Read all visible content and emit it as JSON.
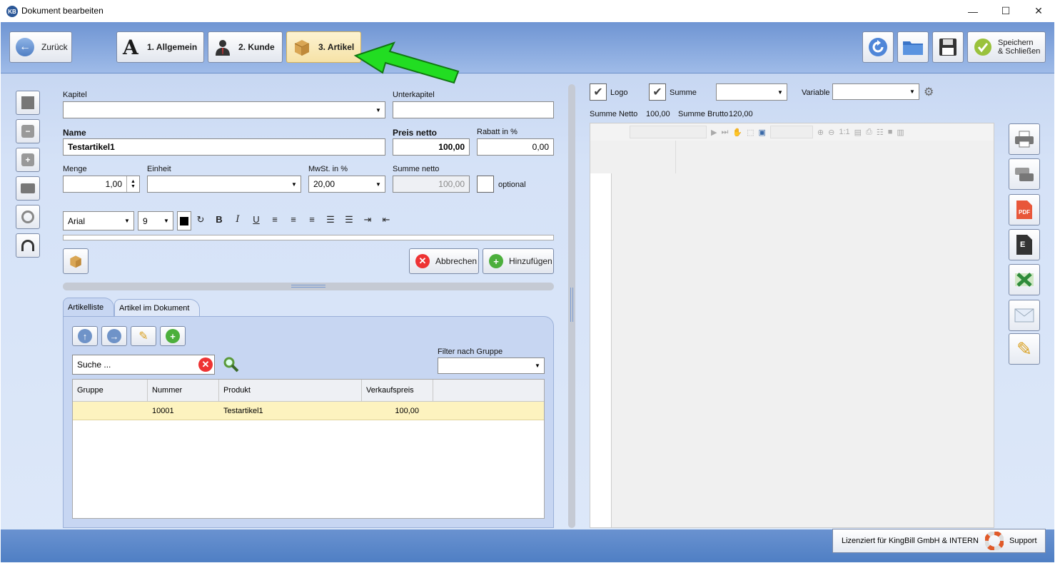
{
  "window": {
    "title": "Dokument bearbeiten",
    "app_icon": "KB"
  },
  "toolbar": {
    "back_label": "Zurück",
    "tab1_label": "1. Allgemein",
    "tab2_label": "2. Kunde",
    "tab3_label": "3. Artikel",
    "save_close_line1": "Speichern",
    "save_close_line2": "& Schließen"
  },
  "form": {
    "kapitel_label": "Kapitel",
    "kapitel_value": "",
    "unterkapitel_label": "Unterkapitel",
    "unterkapitel_value": "",
    "name_label": "Name",
    "name_value": "Testartikel1",
    "preis_label": "Preis netto",
    "preis_value": "100,00",
    "rabatt_label": "Rabatt in %",
    "rabatt_value": "0,00",
    "menge_label": "Menge",
    "menge_value": "1,00",
    "einheit_label": "Einheit",
    "einheit_value": "",
    "mwst_label": "MwSt. in %",
    "mwst_value": "20,00",
    "summe_label": "Summe netto",
    "summe_value": "100,00",
    "optional_label": "optional",
    "font_value": "Arial",
    "size_value": "9",
    "cancel_label": "Abbrechen",
    "add_label": "Hinzufügen"
  },
  "tabs": {
    "tab_a": "Artikelliste",
    "tab_b": "Artikel im Dokument"
  },
  "list": {
    "search_value": "Suche ...",
    "filter_label": "Filter nach Gruppe",
    "filter_value": "",
    "headers": [
      "Gruppe",
      "Nummer",
      "Produkt",
      "Verkaufspreis"
    ],
    "rows": [
      {
        "gruppe": "",
        "nummer": "10001",
        "produkt": "Testartikel1",
        "preis": "100,00"
      }
    ]
  },
  "preview": {
    "logo_label": "Logo",
    "summe_label": "Summe",
    "summe_select": "",
    "variable_label": "Variable",
    "variable_value": "",
    "netto_label": "Summe Netto",
    "netto_value": "100,00",
    "brutto_label": "Summe Brutto",
    "brutto_value": "120,00",
    "zoom_label": "1:1"
  },
  "footer": {
    "license_text": "Lizenziert für KingBill GmbH & INTERN",
    "support_label": "Support"
  },
  "colors": {
    "accent": "#3b6cc4",
    "selected_row": "#fdf3bf",
    "arrow": "#22dd22"
  }
}
